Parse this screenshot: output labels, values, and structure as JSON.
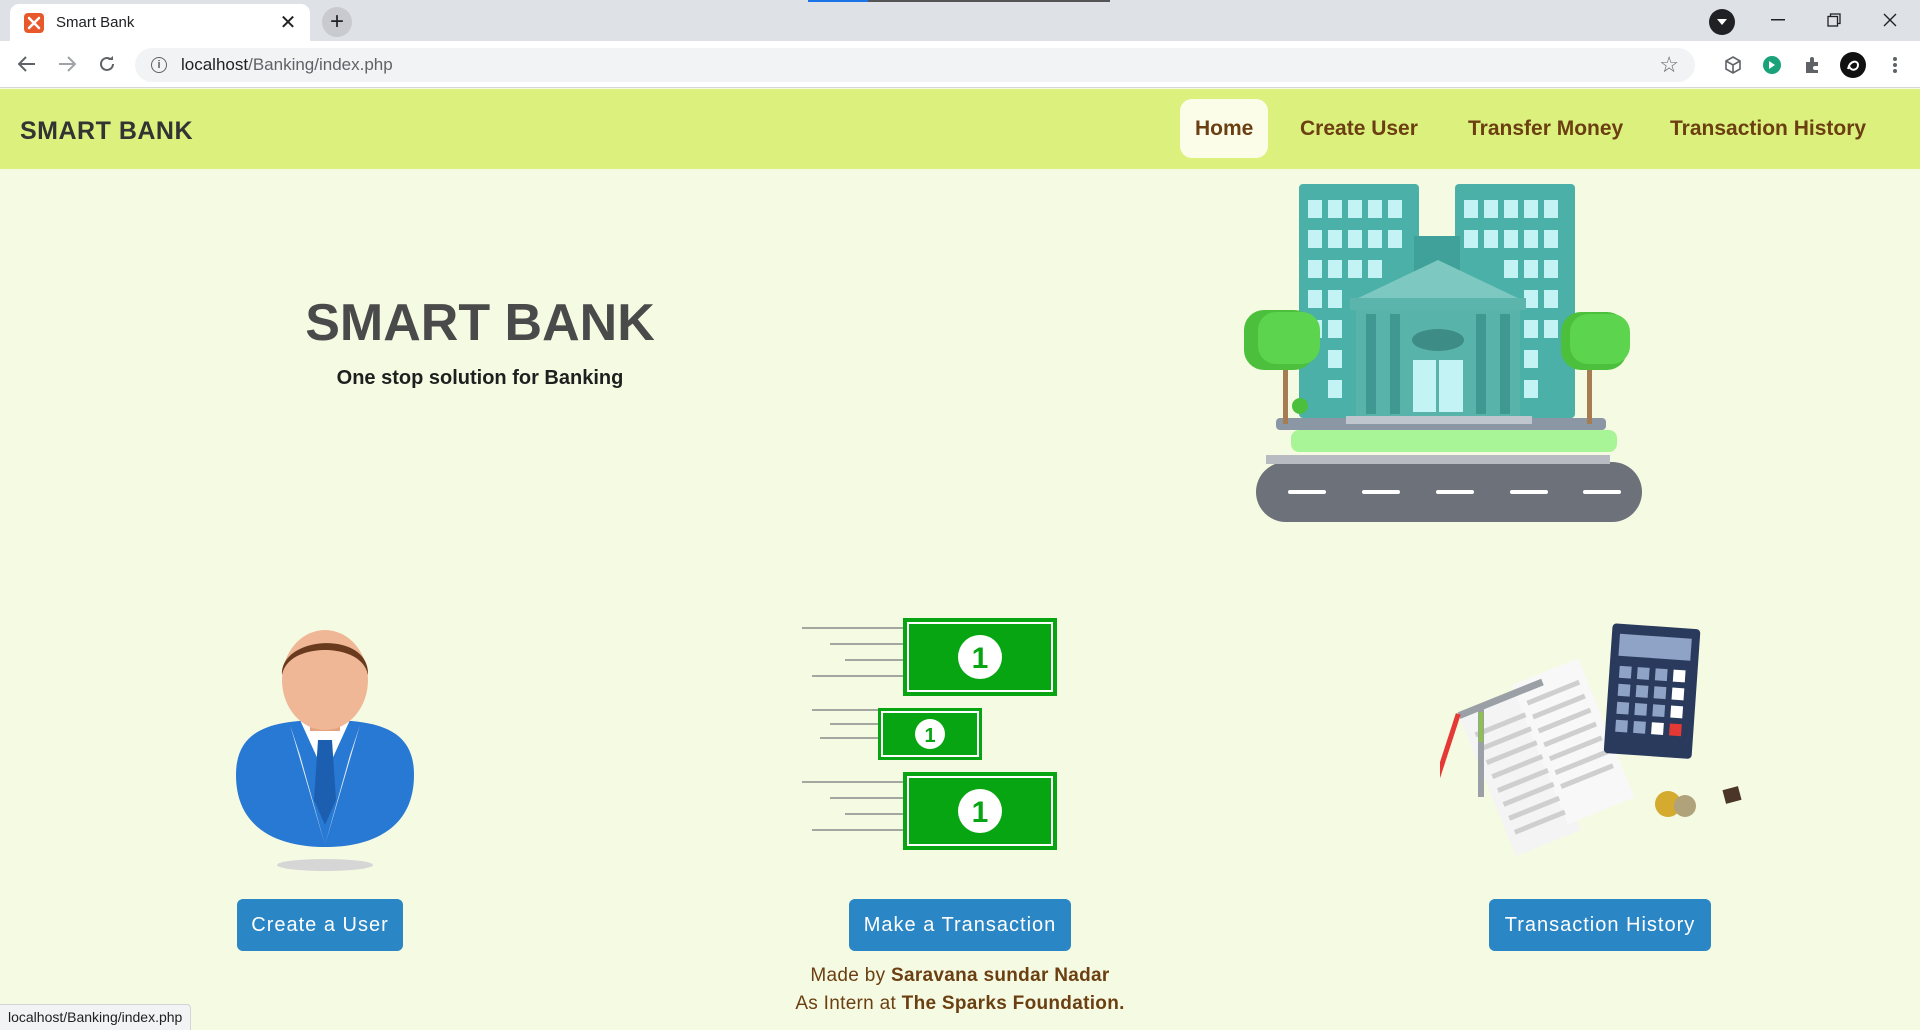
{
  "browser": {
    "tab_title": "Smart Bank",
    "tab_close": "✕",
    "new_tab": "+",
    "url_host": "localhost",
    "url_path": "/Banking/index.php",
    "status_url": "localhost/Banking/index.php",
    "icons": [
      "back-arrow-icon",
      "forward-arrow-icon",
      "reload-icon",
      "info-icon",
      "star-icon",
      "extensions-icon",
      "menu-icon"
    ]
  },
  "nav": {
    "brand": "SMART BANK",
    "links": [
      "Home",
      "Create User",
      "Transfer Money",
      "Transaction History"
    ],
    "active": "Home"
  },
  "hero": {
    "title": "SMART BANK",
    "subtitle": "One stop solution for Banking"
  },
  "features": {
    "create_user": "Create a User",
    "make_transaction": "Make a Transaction",
    "transaction_history": "Transaction History"
  },
  "footer": {
    "made_by_prefix": "Made by",
    "author": "Saravana sundar Nadar",
    "intern_prefix": "As Intern at",
    "organization": "The Sparks Foundation."
  },
  "colors": {
    "navbar": "#dcf07e",
    "page_bg": "#f5fae3",
    "button": "#2a86c5",
    "nav_text": "#6b3f11"
  }
}
